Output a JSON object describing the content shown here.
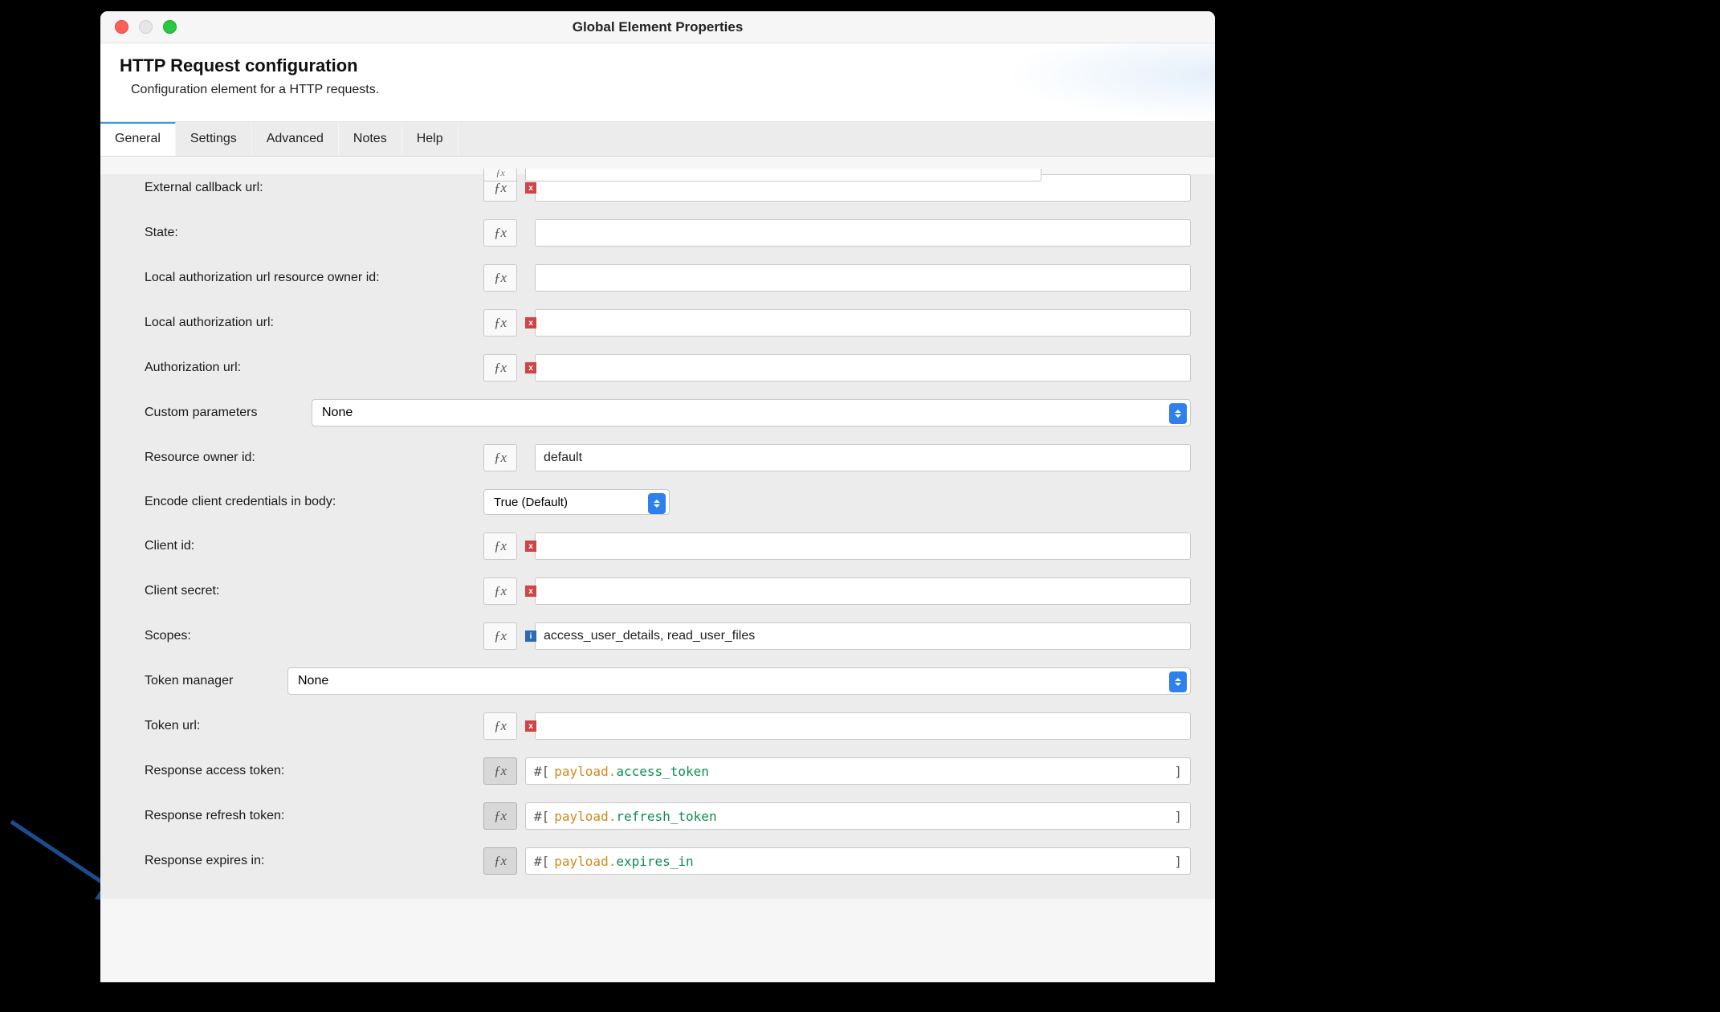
{
  "window": {
    "title": "Global Element Properties"
  },
  "header": {
    "title": "HTTP Request configuration",
    "subtitle": "Configuration element for a HTTP requests."
  },
  "tabs": [
    {
      "label": "General",
      "active": true
    },
    {
      "label": "Settings",
      "active": false
    },
    {
      "label": "Advanced",
      "active": false
    },
    {
      "label": "Notes",
      "active": false
    },
    {
      "label": "Help",
      "active": false
    }
  ],
  "form": {
    "external_callback_url": {
      "label": "External callback url:",
      "value": "",
      "fx": true,
      "error": true
    },
    "state": {
      "label": "State:",
      "value": "",
      "fx": true,
      "error": false
    },
    "local_auth_url_r_owner": {
      "label": "Local authorization url resource owner id:",
      "value": "",
      "fx": true,
      "error": false
    },
    "local_auth_url": {
      "label": "Local authorization url:",
      "value": "",
      "fx": true,
      "error": true
    },
    "authorization_url": {
      "label": "Authorization url:",
      "value": "",
      "fx": true,
      "error": true
    },
    "custom_parameters": {
      "label": "Custom parameters",
      "value": "None"
    },
    "resource_owner_id": {
      "label": "Resource owner id:",
      "value": "default",
      "fx": true,
      "error": false
    },
    "encode_client_creds": {
      "label": "Encode client credentials in body:",
      "value": "True (Default)"
    },
    "client_id": {
      "label": "Client id:",
      "value": "",
      "fx": true,
      "error": true
    },
    "client_secret": {
      "label": "Client secret:",
      "value": "",
      "fx": true,
      "error": true
    },
    "scopes": {
      "label": "Scopes:",
      "value": "access_user_details, read_user_files",
      "fx": true,
      "info": true
    },
    "token_manager": {
      "label": "Token manager",
      "value": "None"
    },
    "token_url": {
      "label": "Token url:",
      "value": "",
      "fx": true,
      "error": true
    },
    "response_access_token": {
      "label": "Response access token:",
      "prefix": "#[ ",
      "obj": "payload",
      "dot": ".",
      "prop": "access_token",
      "suffix": "]"
    },
    "response_refresh_token": {
      "label": "Response refresh token:",
      "prefix": "#[ ",
      "obj": "payload",
      "dot": ".",
      "prop": "refresh_token",
      "suffix": "]"
    },
    "response_expires_in": {
      "label": "Response expires in:",
      "prefix": "#[ ",
      "obj": "payload",
      "dot": ".",
      "prop": "expires_in",
      "suffix": "]"
    }
  },
  "fxGlyph": "ƒx"
}
